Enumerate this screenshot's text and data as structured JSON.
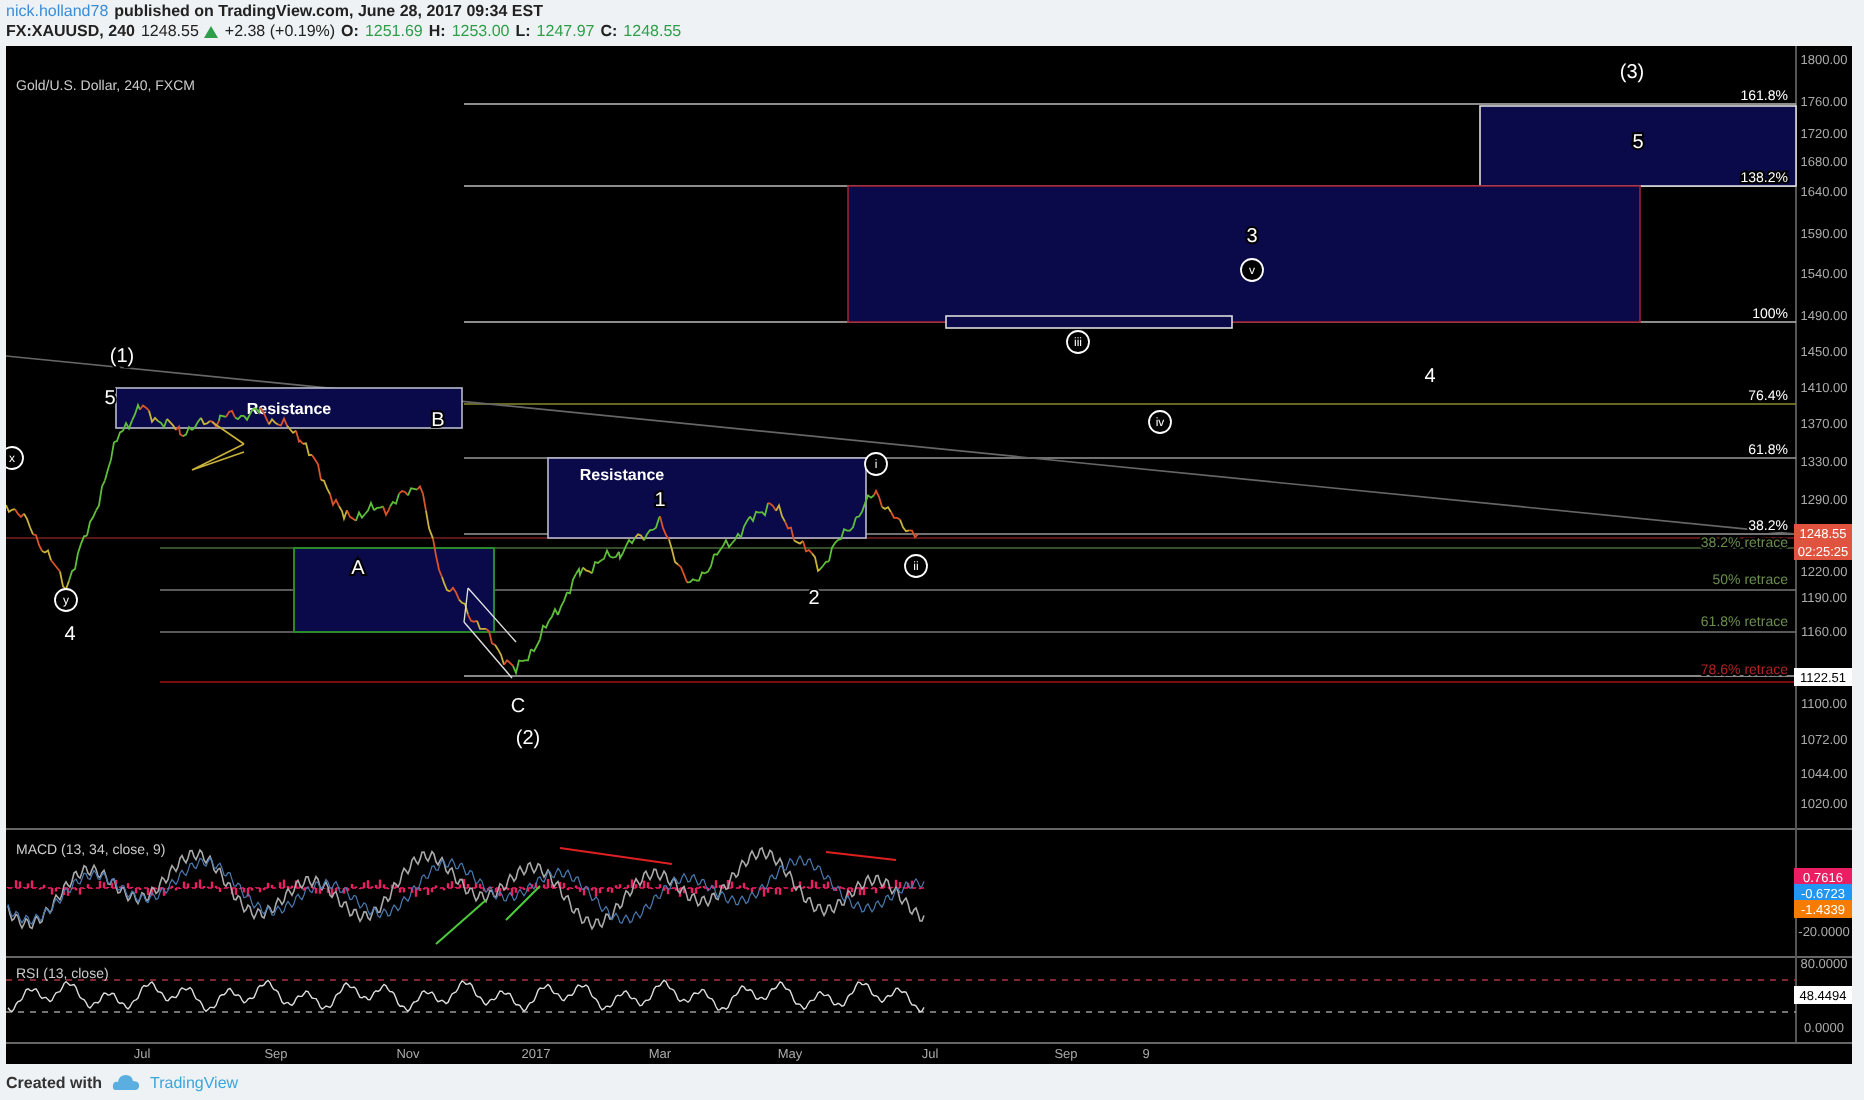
{
  "header": {
    "author": "nick.holland78",
    "published": "published on TradingView.com, June 28, 2017 09:34 EST",
    "symbol": "FX:XAUUSD, 240",
    "last": "1248.55",
    "change": "+2.38 (+0.19%)",
    "ohlc": [
      {
        "label": "O:",
        "value": "1251.69"
      },
      {
        "label": "H:",
        "value": "1253.00"
      },
      {
        "label": "L:",
        "value": "1247.97"
      },
      {
        "label": "C:",
        "value": "1248.55"
      }
    ]
  },
  "chart": {
    "title": "Gold/U.S. Dollar, 240, FXCM",
    "resistance_boxes": [
      "Resistance",
      "Resistance"
    ],
    "wave_labels": [
      {
        "text": "(1)",
        "kind": "plain"
      },
      {
        "text": "5",
        "kind": "plain"
      },
      {
        "text": "x",
        "kind": "circled"
      },
      {
        "text": "y",
        "kind": "circled"
      },
      {
        "text": "4",
        "kind": "plain"
      },
      {
        "text": "B",
        "kind": "plain"
      },
      {
        "text": "A",
        "kind": "plain"
      },
      {
        "text": "C",
        "kind": "plain"
      },
      {
        "text": "(2)",
        "kind": "plain"
      },
      {
        "text": "1",
        "kind": "plain"
      },
      {
        "text": "2",
        "kind": "plain"
      },
      {
        "text": "i",
        "kind": "circled"
      },
      {
        "text": "ii",
        "kind": "circled"
      },
      {
        "text": "iii",
        "kind": "circled"
      },
      {
        "text": "iv",
        "kind": "circled"
      },
      {
        "text": "3",
        "kind": "plain"
      },
      {
        "text": "v",
        "kind": "circled"
      },
      {
        "text": "4",
        "kind": "plain"
      },
      {
        "text": "5",
        "kind": "plain"
      },
      {
        "text": "(3)",
        "kind": "plain"
      }
    ],
    "fib_levels": [
      {
        "label": "161.8%",
        "color": "#ffffff"
      },
      {
        "label": "138.2%",
        "color": "#ffffff"
      },
      {
        "label": "100%",
        "color": "#ffffff"
      },
      {
        "label": "76.4%",
        "color": "#ffffff"
      },
      {
        "label": "61.8%",
        "color": "#ffffff"
      },
      {
        "label": "38.2%",
        "color": "#ffffff"
      },
      {
        "label": "38.2% retrace",
        "color": "#6b8e4e"
      },
      {
        "label": "50% retrace",
        "color": "#6b8e4e"
      },
      {
        "label": "61.8% retrace",
        "color": "#6b8e4e"
      },
      {
        "label": "78.6% retrace",
        "color": "#b22222"
      }
    ],
    "price_axis": [
      "1800.00",
      "1760.00",
      "1720.00",
      "1680.00",
      "1640.00",
      "1590.00",
      "1540.00",
      "1490.00",
      "1450.00",
      "1410.00",
      "1370.00",
      "1330.00",
      "1290.00",
      "1220.00",
      "1190.00",
      "1160.00",
      "1100.00",
      "1072.00",
      "1044.00",
      "1020.00"
    ],
    "price_tags": [
      {
        "text": "1248.55",
        "color": "#e0533f"
      },
      {
        "text": "02:25:25",
        "color": "#e0533f"
      },
      {
        "text": "1122.51",
        "color": "#ffffff"
      }
    ]
  },
  "macd": {
    "title": "MACD (13, 34, close, 9)",
    "axis": [
      "-20.0000"
    ],
    "tags": [
      {
        "text": "0.7616",
        "color": "#e91e63"
      },
      {
        "text": "-0.6723",
        "color": "#2196f3"
      },
      {
        "text": "-1.4339",
        "color": "#f57c00"
      }
    ]
  },
  "rsi": {
    "title": "RSI (13, close)",
    "axis": [
      "80.0000",
      "0.0000"
    ],
    "tags": [
      {
        "text": "48.4494",
        "color": "#ffffff"
      }
    ]
  },
  "time_axis": [
    "Jul",
    "Sep",
    "Nov",
    "2017",
    "Mar",
    "May",
    "Jul",
    "Sep",
    "9"
  ],
  "footer": {
    "prefix": "Created with",
    "brand": "TradingView"
  }
}
